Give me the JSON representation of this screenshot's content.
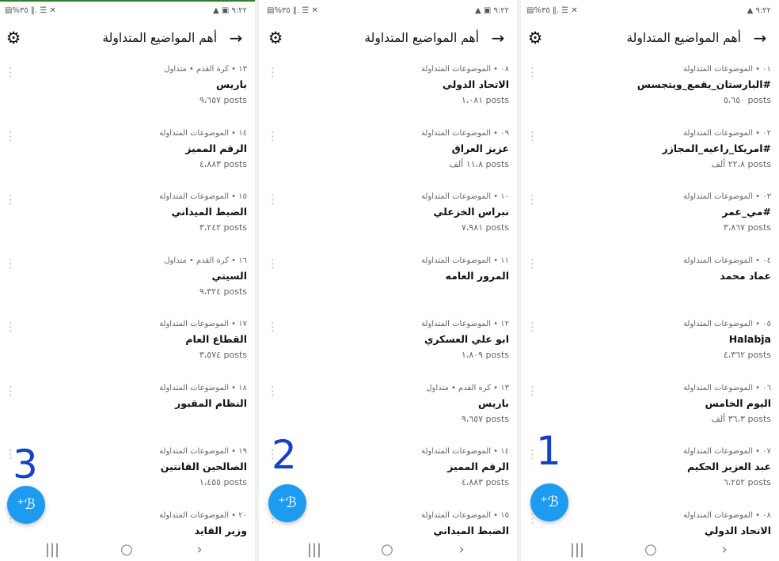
{
  "colors": {
    "fab": "#1d9bf0",
    "annotation": "#1540c8",
    "accent_bar": "#2e7d32"
  },
  "icons": {
    "settings": "gear-icon",
    "back": "arrow-right-icon",
    "more": "more-vertical-icon",
    "compose": "feather-plus-icon",
    "nav_recent": "recent-apps-icon",
    "nav_home": "home-icon",
    "nav_back": "back-chevron-icon"
  },
  "panels": [
    {
      "status_left": "▤%٣٥ ‖. ☰ ✕",
      "status_right": "▲ ▣ ٩:٢٢",
      "title": "أهم المواضيع المتداولة",
      "annotation": "3",
      "items": [
        {
          "topic": "١٣ • كرة القدم • متداول",
          "name": "باريس",
          "count": "٩،٦٥٧ posts"
        },
        {
          "topic": "١٤ • الموضوعات المتداولة",
          "name": "الرقم المميز",
          "count": "٤،٨٨٣ posts"
        },
        {
          "topic": "١٥ • الموضوعات المتداولة",
          "name": "الضبط الميداني",
          "count": "٣،٢٤٢ posts"
        },
        {
          "topic": "١٦ • كرة القدم • متداول",
          "name": "السيتي",
          "count": "٩،٣٢٤ posts"
        },
        {
          "topic": "١٧ • الموضوعات المتداولة",
          "name": "القطاع العام",
          "count": "٣،٥٧٤ posts"
        },
        {
          "topic": "١٨ • الموضوعات المتداولة",
          "name": "النظام المقبور",
          "count": ""
        },
        {
          "topic": "١٩ • الموضوعات المتداولة",
          "name": "الصالحين القانتين",
          "count": "١،٤٥٥ posts"
        },
        {
          "topic": "٢٠ • الموضوعات المتداولة",
          "name": "وزير القايد",
          "count": ""
        }
      ]
    },
    {
      "status_left": "▤%٣٥ ‖. ☰ ✕",
      "status_right": "▲ ▣ ٩:٢٢",
      "title": "أهم المواضيع المتداولة",
      "annotation": "2",
      "items": [
        {
          "topic": "٠٨ • الموضوعات المتداولة",
          "name": "الاتحاد الدولي",
          "count": "١،٠٨١ posts"
        },
        {
          "topic": "٠٩ • الموضوعات المتداولة",
          "name": "عزيز العراق",
          "count": "١١،٨ ألف posts"
        },
        {
          "topic": "١٠ • الموضوعات المتداولة",
          "name": "نبراس الخزعلي",
          "count": "٧،٩٨١ posts"
        },
        {
          "topic": "١١ • الموضوعات المتداولة",
          "name": "المرور العامه",
          "count": ""
        },
        {
          "topic": "١٢ • الموضوعات المتداولة",
          "name": "ابو علي العسكري",
          "count": "١،٨٠٩ posts"
        },
        {
          "topic": "١٣ • كرة القدم • متداول",
          "name": "باريس",
          "count": "٩،٦٥٧ posts"
        },
        {
          "topic": "١٤ • الموضوعات المتداولة",
          "name": "الرقم المميز",
          "count": "٤،٨٨٣ posts"
        },
        {
          "topic": "١٥ • الموضوعات المتداولة",
          "name": "الضبط الميداني",
          "count": ""
        }
      ]
    },
    {
      "status_left": "▤%٣٥ ‖. ☰ ✕",
      "status_right": "▲ ٩:٢٢",
      "title": "أهم المواضيع المتداولة",
      "annotation": "1",
      "items": [
        {
          "topic": "٠١ • الموضوعات المتداولة",
          "name": "#البارستان_يقمع_ويتجسس",
          "count": "٥،٦٥٠ posts"
        },
        {
          "topic": "٠٢ • الموضوعات المتداولة",
          "name": "#امريكا_راعيه_المجازر",
          "count": "٢٢،٨ ألف posts"
        },
        {
          "topic": "٠٣ • الموضوعات المتداولة",
          "name": "#مي_عمر",
          "count": "٣،٨٦٧ posts"
        },
        {
          "topic": "٠٤ • الموضوعات المتداولة",
          "name": "عماد محمد",
          "count": ""
        },
        {
          "topic": "٠٥ • الموضوعات المتداولة",
          "name": "Halabja",
          "count": "٤،٣٦٢ posts"
        },
        {
          "topic": "٠٦ • الموضوعات المتداولة",
          "name": "اليوم الخامس",
          "count": "٣٦،٣ ألف posts"
        },
        {
          "topic": "٠٧ • الموضوعات المتداولة",
          "name": "عبد العزيز الحكيم",
          "count": "٦،٢٥٢ posts"
        },
        {
          "topic": "٠٨ • الموضوعات المتداولة",
          "name": "الاتحاد الدولي",
          "count": ""
        }
      ]
    }
  ],
  "navbar": {
    "recent": "|||",
    "home": "○",
    "back": "›"
  }
}
